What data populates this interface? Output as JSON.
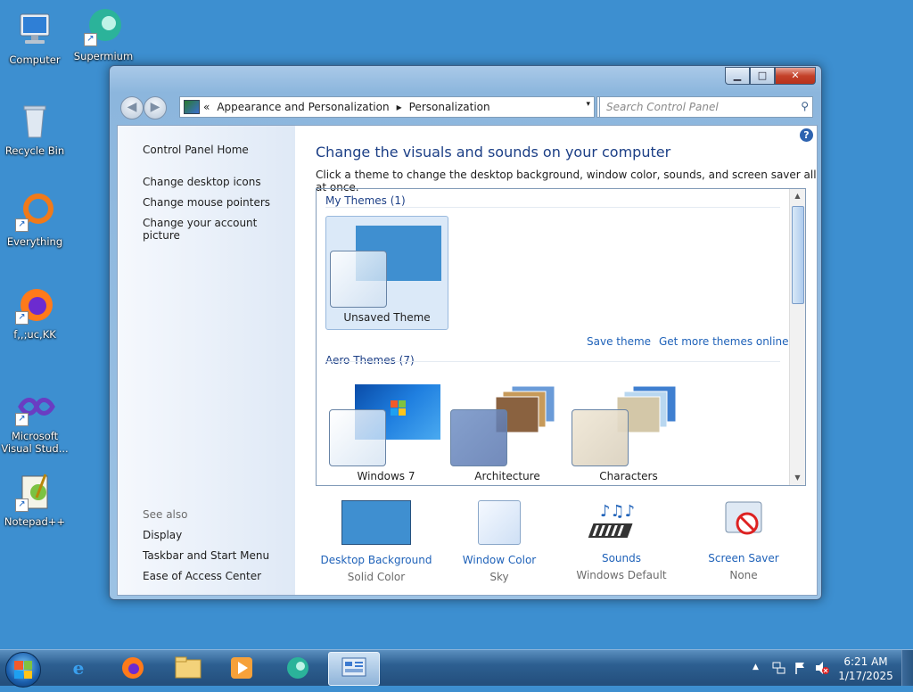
{
  "desktop": {
    "icons": [
      {
        "label": "Computer",
        "icon": "computer-icon"
      },
      {
        "label": "Supermium",
        "icon": "supermium-icon"
      },
      {
        "label": "Recycle Bin",
        "icon": "recycle-bin-icon"
      },
      {
        "label": "Everything",
        "icon": "everything-icon"
      },
      {
        "label": "f,,;uc,KK",
        "icon": "firefox-icon"
      },
      {
        "label": "Microsoft Visual Stud...",
        "icon": "visual-studio-icon"
      },
      {
        "label": "Notepad++",
        "icon": "notepadpp-icon"
      }
    ]
  },
  "window": {
    "controls": {
      "minimize": "▁",
      "maximize": "□",
      "close": "✕"
    },
    "nav": {
      "back": "◀",
      "forward": "▶"
    },
    "address": {
      "prefix": "«",
      "segments": [
        "Appearance and Personalization",
        "Personalization"
      ],
      "separator": "▸",
      "dropdown": "▾",
      "refresh": "↻"
    },
    "search": {
      "placeholder": "Search Control Panel",
      "icon": "⚲"
    },
    "left": {
      "home": "Control Panel Home",
      "links": [
        "Change desktop icons",
        "Change mouse pointers",
        "Change your account picture"
      ],
      "see_also_label": "See also",
      "see_also": [
        "Display",
        "Taskbar and Start Menu",
        "Ease of Access Center"
      ]
    },
    "help": "?",
    "title": "Change the visuals and sounds on your computer",
    "description": "Click a theme to change the desktop background, window color, sounds, and screen saver all at once.",
    "themes": {
      "my_themes_label": "My Themes (1)",
      "my_themes": [
        {
          "name": "Unsaved Theme",
          "selected": true
        }
      ],
      "save_theme": "Save theme",
      "get_more": "Get more themes online",
      "aero_label": "Aero Themes (7)",
      "aero": [
        {
          "name": "Windows 7"
        },
        {
          "name": "Architecture"
        },
        {
          "name": "Characters"
        }
      ]
    },
    "options": [
      {
        "title": "Desktop Background",
        "value": "Solid Color",
        "icon": "desktop-background-icon"
      },
      {
        "title": "Window Color",
        "value": "Sky",
        "icon": "window-color-icon"
      },
      {
        "title": "Sounds",
        "value": "Windows Default",
        "icon": "sounds-icon"
      },
      {
        "title": "Screen Saver",
        "value": "None",
        "icon": "screen-saver-icon"
      }
    ]
  },
  "taskbar": {
    "time": "6:21 AM",
    "date": "1/17/2025",
    "tray_arrow": "▲",
    "colors": {
      "desktop": "#3d8fd0",
      "accent": "#1c3f86",
      "link": "#1f62b9"
    }
  }
}
